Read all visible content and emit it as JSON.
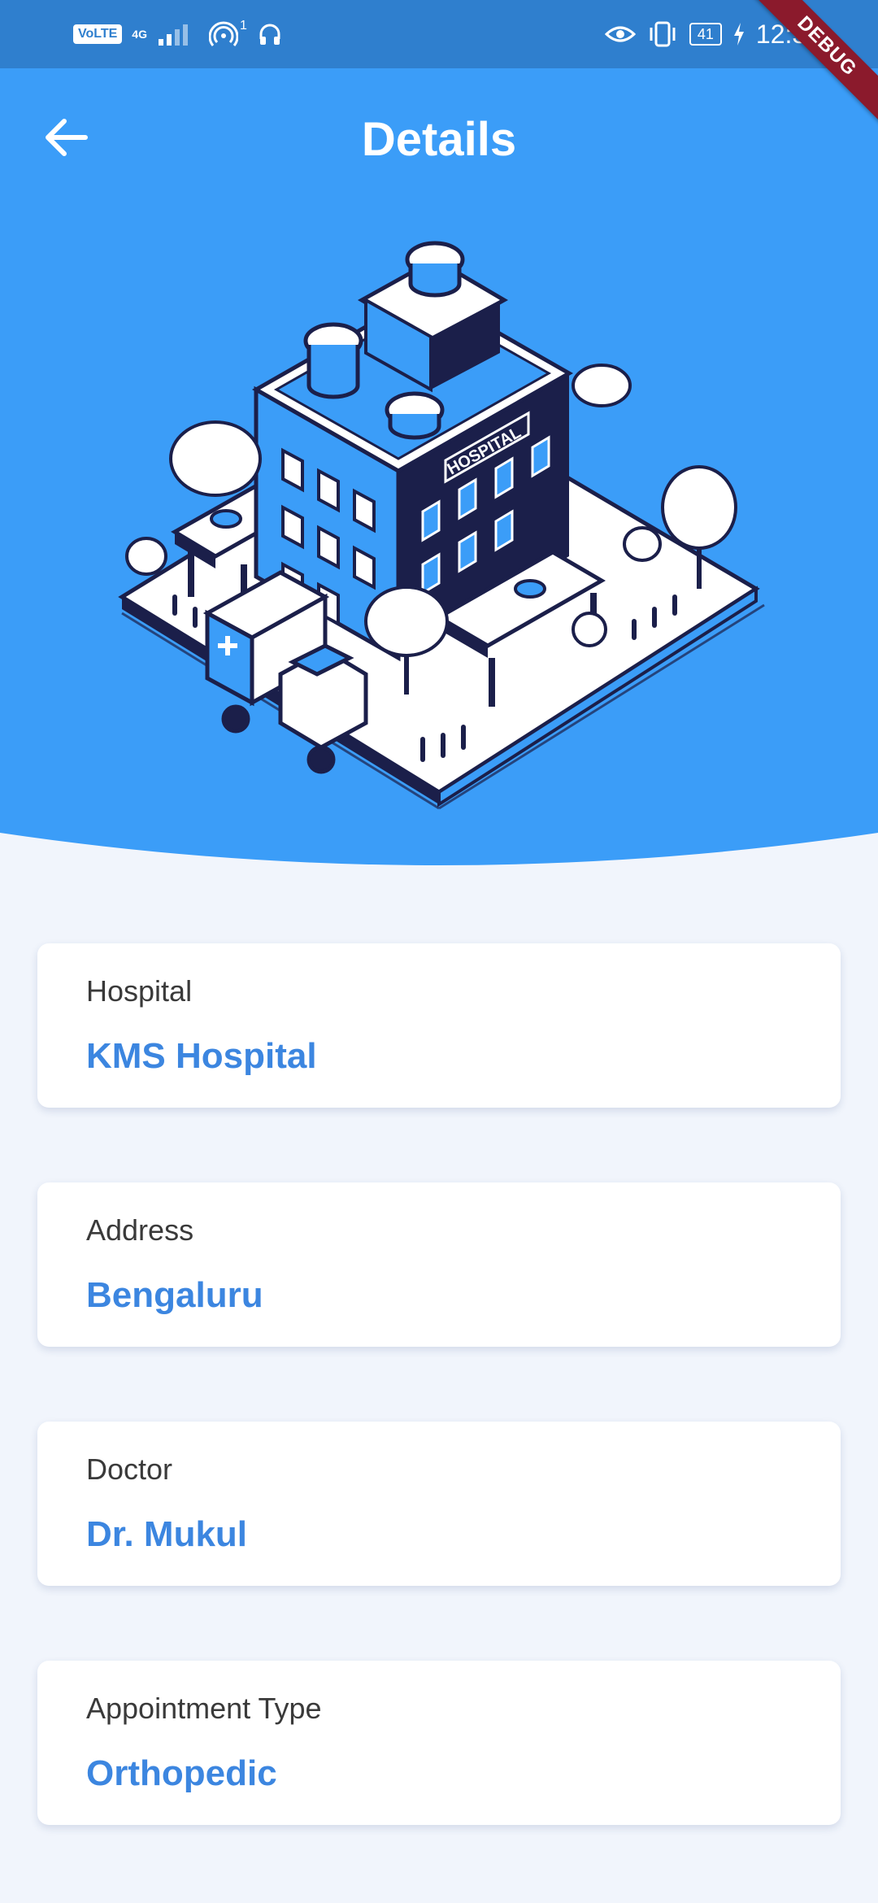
{
  "status_bar": {
    "volte": "VoLTE",
    "network": "4G",
    "hotspot_count": "1",
    "battery": "41",
    "time": "12:33"
  },
  "debug_banner": "DEBUG",
  "header": {
    "title": "Details"
  },
  "hero": {
    "sign_text": "HOSPITAL"
  },
  "cards": [
    {
      "label": "Hospital",
      "value": "KMS Hospital"
    },
    {
      "label": "Address",
      "value": "Bengaluru"
    },
    {
      "label": "Doctor",
      "value": "Dr. Mukul"
    },
    {
      "label": "Appointment Type",
      "value": "Orthopedic"
    }
  ],
  "colors": {
    "primary": "#3b9df8",
    "status_bar": "#2f7fce",
    "value_text": "#3c86e0",
    "background": "#f1f5fc",
    "debug": "#8b1a2c"
  },
  "icons": [
    "back-arrow-icon",
    "hotspot-icon",
    "headphones-icon",
    "eye-icon",
    "vibrate-icon",
    "charging-icon"
  ]
}
